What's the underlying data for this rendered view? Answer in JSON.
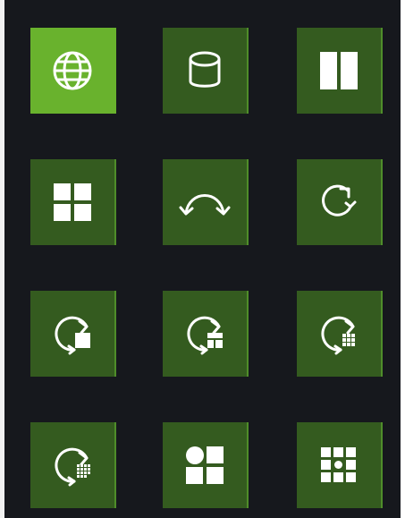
{
  "palette": {
    "background": "#16181d",
    "tile": "#345b1f",
    "tile_selected": "#69b22d",
    "icon": "#ffffff"
  },
  "selected_index": 0,
  "tiles": [
    {
      "icon": "globe-icon",
      "selected": true
    },
    {
      "icon": "cylinder-icon",
      "selected": false
    },
    {
      "icon": "two-columns-icon",
      "selected": false
    },
    {
      "icon": "four-squares-icon",
      "selected": false
    },
    {
      "icon": "curved-double-arrow-icon",
      "selected": false
    },
    {
      "icon": "refresh-icon",
      "selected": false
    },
    {
      "icon": "rotate-single-block-icon",
      "selected": false
    },
    {
      "icon": "rotate-panel-grid-icon",
      "selected": false
    },
    {
      "icon": "rotate-dense-grid-icon",
      "selected": false
    },
    {
      "icon": "rotate-small-grid-icon",
      "selected": false
    },
    {
      "icon": "shapes-mixed-icon",
      "selected": false
    },
    {
      "icon": "dotted-grid-icon",
      "selected": false
    }
  ]
}
